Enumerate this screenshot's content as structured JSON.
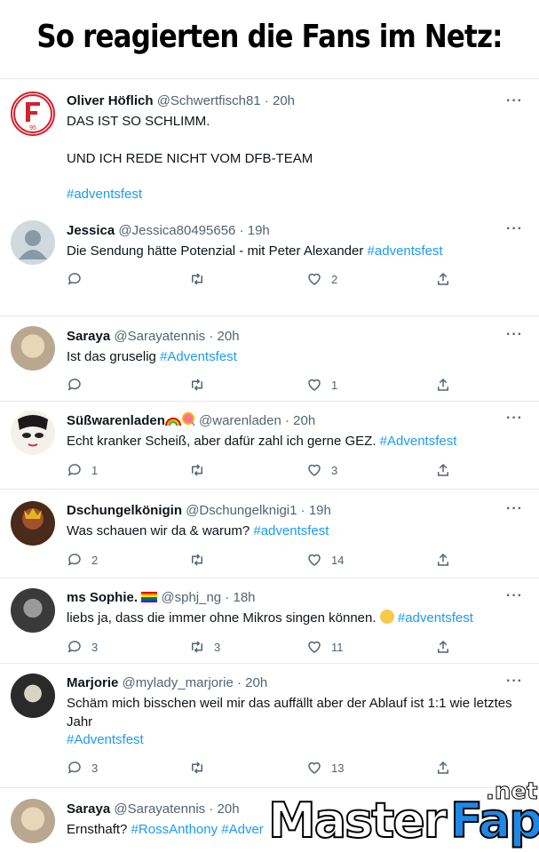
{
  "headline": "So reagierten die Fans im Netz:",
  "more_label": "···",
  "tweets": [
    {
      "name": "Oliver Höflich",
      "handle": "@Schwertfisch81",
      "time": "20h",
      "lines": [
        "DAS IST SO SCHLIMM.",
        "UND ICH REDE NICHT VOM DFB-TEAM"
      ],
      "tag": "#adventsfest"
    },
    {
      "name": "Jessica",
      "handle": "@Jessica80495656",
      "time": "19h",
      "text": "Die Sendung hätte Potenzial - mit Peter Alexander",
      "tag": "#adventsfest",
      "replies": "",
      "retweets": "",
      "likes": "2"
    },
    {
      "name": "Saraya",
      "handle": "@Sarayatennis",
      "time": "20h",
      "text": "Ist das gruselig",
      "tag": "#Adventsfest",
      "replies": "",
      "retweets": "",
      "likes": "1"
    },
    {
      "name": "Süßwarenladen",
      "handle": "@warenladen",
      "time": "20h",
      "text": "Echt kranker Scheiß, aber dafür zahl ich gerne GEZ.",
      "tag": "#Adventsfest",
      "replies": "1",
      "retweets": "",
      "likes": "3"
    },
    {
      "name": "Dschungelkönigin",
      "handle": "@Dschungelknigi1",
      "time": "19h",
      "text": "Was schauen wir da & warum?",
      "tag": "#adventsfest",
      "replies": "2",
      "retweets": "",
      "likes": "14"
    },
    {
      "name": "ms Sophie.",
      "handle": "@sphj_ng",
      "time": "18h",
      "text": "liebs ja, dass die immer ohne Mikros singen können.",
      "tag": "#adventsfest",
      "replies": "3",
      "retweets": "3",
      "likes": "11"
    },
    {
      "name": "Marjorie",
      "handle": "@mylady_marjorie",
      "time": "20h",
      "line1": "Schäm mich bisschen weil mir das auffällt aber der Ablauf ist 1:1 wie letztes",
      "line2": "Jahr",
      "tag": "#Adventsfest",
      "replies": "3",
      "retweets": "",
      "likes": "13"
    },
    {
      "name": "Saraya",
      "handle": "@Sarayatennis",
      "time": "20h",
      "text": "Ernsthaft?",
      "tag": "#RossAnthony #Adver"
    }
  ],
  "avatar_badge": "95",
  "watermark": {
    "master": "Master",
    "fap": "Fap",
    "net": ".net"
  },
  "colors": {
    "link": "#1d9bf0",
    "muted": "#536471",
    "text": "#0f1419",
    "fap_blue": "#1e88e5"
  },
  "icons": [
    "reply-icon",
    "retweet-icon",
    "like-icon",
    "share-icon",
    "more-icon"
  ]
}
